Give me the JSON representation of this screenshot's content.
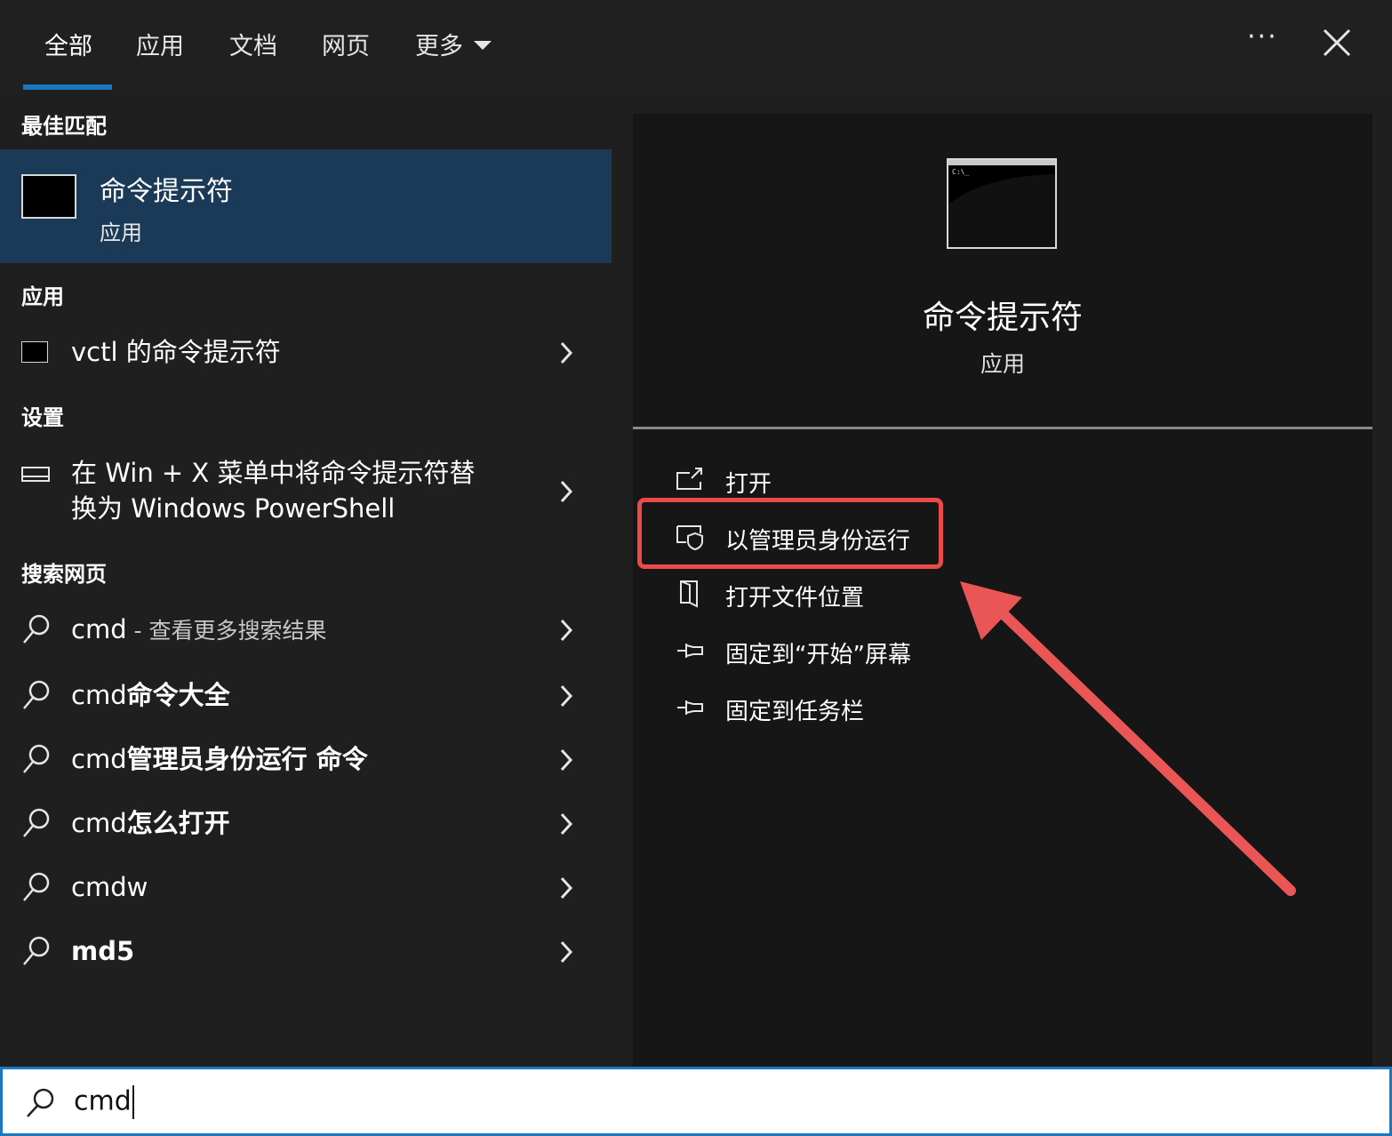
{
  "tabs": [
    {
      "label": "全部",
      "active": true
    },
    {
      "label": "应用"
    },
    {
      "label": "文档"
    },
    {
      "label": "网页"
    },
    {
      "label": "更多"
    }
  ],
  "topbar": {
    "more_options": "···"
  },
  "left": {
    "best_match": {
      "heading": "最佳匹配",
      "title": "命令提示符",
      "subtitle": "应用"
    },
    "apps": {
      "heading": "应用",
      "items": [
        {
          "label": "vctl 的命令提示符"
        }
      ]
    },
    "settings": {
      "heading": "设置",
      "items": [
        {
          "line1": "在 Win + X 菜单中将命令提示符替",
          "line2": "换为 Windows PowerShell"
        }
      ]
    },
    "web": {
      "heading": "搜索网页",
      "items": [
        {
          "prefix": "cmd",
          "suffix": " - 查看更多搜索结果"
        },
        {
          "prefix": "cmd",
          "bold": "命令大全"
        },
        {
          "prefix": "cmd",
          "bold": "管理员身份运行 命令"
        },
        {
          "prefix": "cmd",
          "bold": "怎么打开"
        },
        {
          "prefix": "cmdw",
          "bold": ""
        },
        {
          "prefix": "",
          "bold": "md5"
        }
      ]
    }
  },
  "right": {
    "title": "命令提示符",
    "subtitle": "应用",
    "actions": [
      {
        "label": "打开",
        "icon": "open-icon"
      },
      {
        "label": "以管理员身份运行",
        "icon": "shield-icon"
      },
      {
        "label": "打开文件位置",
        "icon": "file-location-icon"
      },
      {
        "label": "固定到“开始”屏幕",
        "icon": "pin-icon"
      },
      {
        "label": "固定到任务栏",
        "icon": "pin-icon"
      }
    ]
  },
  "search": {
    "value": "cmd"
  },
  "colors": {
    "accent": "#1a78c2",
    "selected_row": "#1b3a57",
    "annotation": "#ea4a4a"
  }
}
